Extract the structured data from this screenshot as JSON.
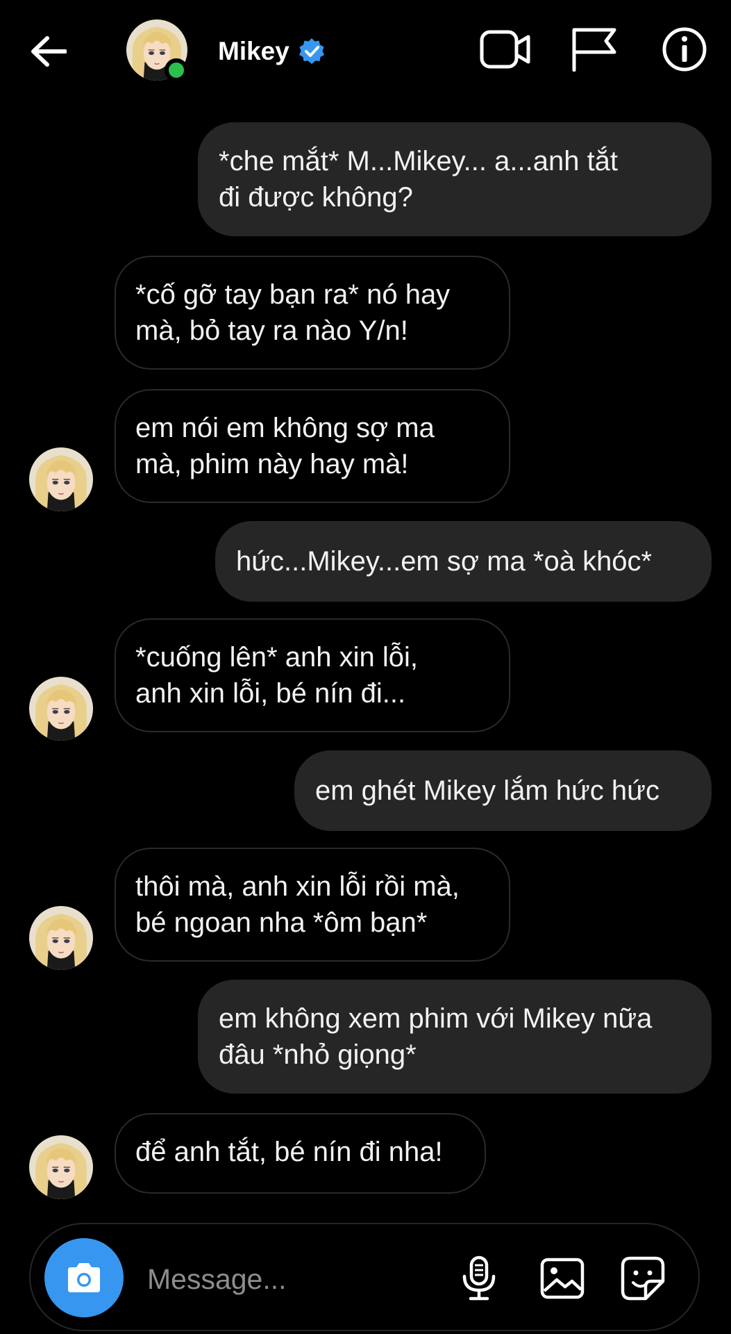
{
  "header": {
    "name": "Mikey",
    "icons": {
      "back": "arrow-left-icon",
      "verified": "verified-badge-icon",
      "video": "video-camera-icon",
      "report": "flag-icon",
      "info": "info-icon"
    },
    "status": "online"
  },
  "messages": [
    {
      "from": "me",
      "text": "*che mắt* M...Mikey... a...anh tắt\nđi được không?"
    },
    {
      "from": "them",
      "text": "*cố gỡ tay bạn ra* nó hay\nmà, bỏ tay ra nào Y/n!"
    },
    {
      "from": "them",
      "text": "em nói em không sợ ma\nmà, phim này hay mà!"
    },
    {
      "from": "me",
      "text": "hức...Mikey...em sợ ma *oà khóc*"
    },
    {
      "from": "them",
      "text": "*cuống lên* anh xin lỗi,\nanh xin lỗi, bé nín đi..."
    },
    {
      "from": "me",
      "text": "em ghét Mikey lắm hức hức"
    },
    {
      "from": "them",
      "text": "thôi mà, anh xin lỗi rồi mà,\nbé ngoan nha *ôm bạn*"
    },
    {
      "from": "me",
      "text": "em không xem phim với Mikey nữa\nđâu *nhỏ giọng*"
    },
    {
      "from": "them",
      "text": "để anh tắt, bé nín đi nha!"
    }
  ],
  "composer": {
    "placeholder": "Message...",
    "icons": [
      "camera-icon",
      "microphone-icon",
      "gallery-icon",
      "sticker-icon"
    ]
  },
  "colors": {
    "background": "#000000",
    "sent_bubble": "#262626",
    "received_border": "#2a2a2a",
    "accent_blue": "#3797f0",
    "online_green": "#2bbf4c",
    "verified_blue": "#3797f0"
  }
}
